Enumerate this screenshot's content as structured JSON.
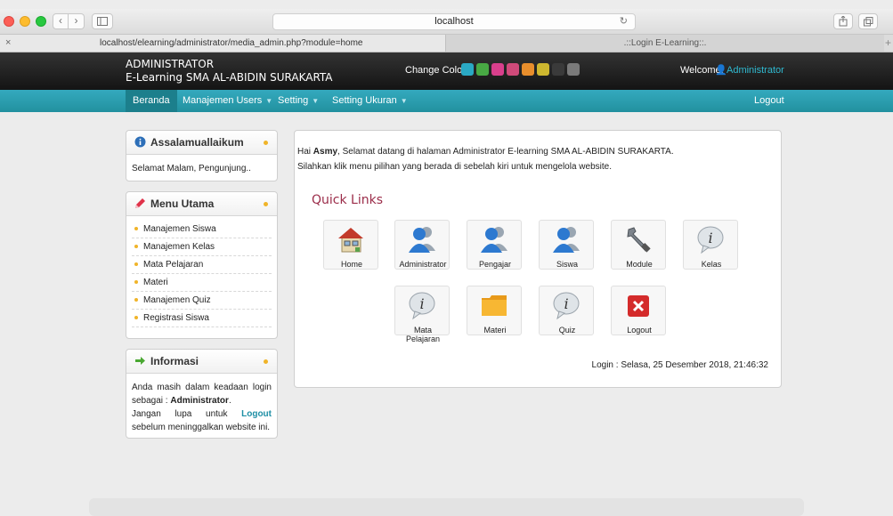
{
  "browser": {
    "address": "localhost",
    "tabs": [
      {
        "title": "localhost/elearning/administrator/media_admin.php?module=home"
      },
      {
        "title": ".::Login E-Learning::."
      }
    ],
    "new_tab": "+"
  },
  "header": {
    "brand_line1": "ADMINISTRATOR",
    "brand_line2": "E-Learning SMA AL-ABIDIN SURAKARTA",
    "change_color_label": "Change Color",
    "swatches": [
      "#2aa9c4",
      "#48a944",
      "#d93f8c",
      "#cf4a7a",
      "#e88e2c",
      "#cdb72f",
      "#3a3a3a",
      "#7a7a7a"
    ],
    "welcome_label": "Welcome,",
    "user_name": "Administrator"
  },
  "nav": {
    "beranda": "Beranda",
    "manajemen_users": "Manajemen Users",
    "setting": "Setting",
    "setting_ukuran": "Setting Ukuran",
    "logout": "Logout"
  },
  "sidebar": {
    "box1": {
      "title": "Assalamuallaikum",
      "body": "Selamat Malam, Pengunjung.."
    },
    "box2": {
      "title": "Menu Utama",
      "items": [
        "Manajemen Siswa",
        "Manajemen Kelas",
        "Mata Pelajaran",
        "Materi",
        "Manajemen Quiz",
        "Registrasi Siswa"
      ]
    },
    "box3": {
      "title": "Informasi",
      "text1": "Anda masih dalam keadaan login sebagai : ",
      "role": "Administrator",
      "text2": "Jangan lupa untuk ",
      "logout": "Logout",
      "text3": " sebelum meninggalkan website ini."
    }
  },
  "main": {
    "greet_prefix": "Hai ",
    "greet_name": "Asmy",
    "greet_rest": ", Selamat datang di halaman Administrator E-learning SMA AL-ABIDIN SURAKARTA.",
    "greet_line2": "Silahkan klik menu pilihan yang berada di sebelah kiri untuk mengelola website.",
    "quick_links_title": "Quick Links",
    "quick_links": [
      {
        "label": "Home",
        "icon": "home-icon"
      },
      {
        "label": "Administrator",
        "icon": "users-icon"
      },
      {
        "label": "Pengajar",
        "icon": "users-icon"
      },
      {
        "label": "Siswa",
        "icon": "users-icon"
      },
      {
        "label": "Module",
        "icon": "wrench-icon"
      },
      {
        "label": "Kelas",
        "icon": "info-icon"
      },
      {
        "label": "Mata Pelajaran",
        "icon": "info-icon"
      },
      {
        "label": "Materi",
        "icon": "folder-icon"
      },
      {
        "label": "Quiz",
        "icon": "info-icon"
      },
      {
        "label": "Logout",
        "icon": "close-icon"
      }
    ],
    "login_info": "Login : Selasa, 25 Desember 2018, 21:46:32"
  }
}
